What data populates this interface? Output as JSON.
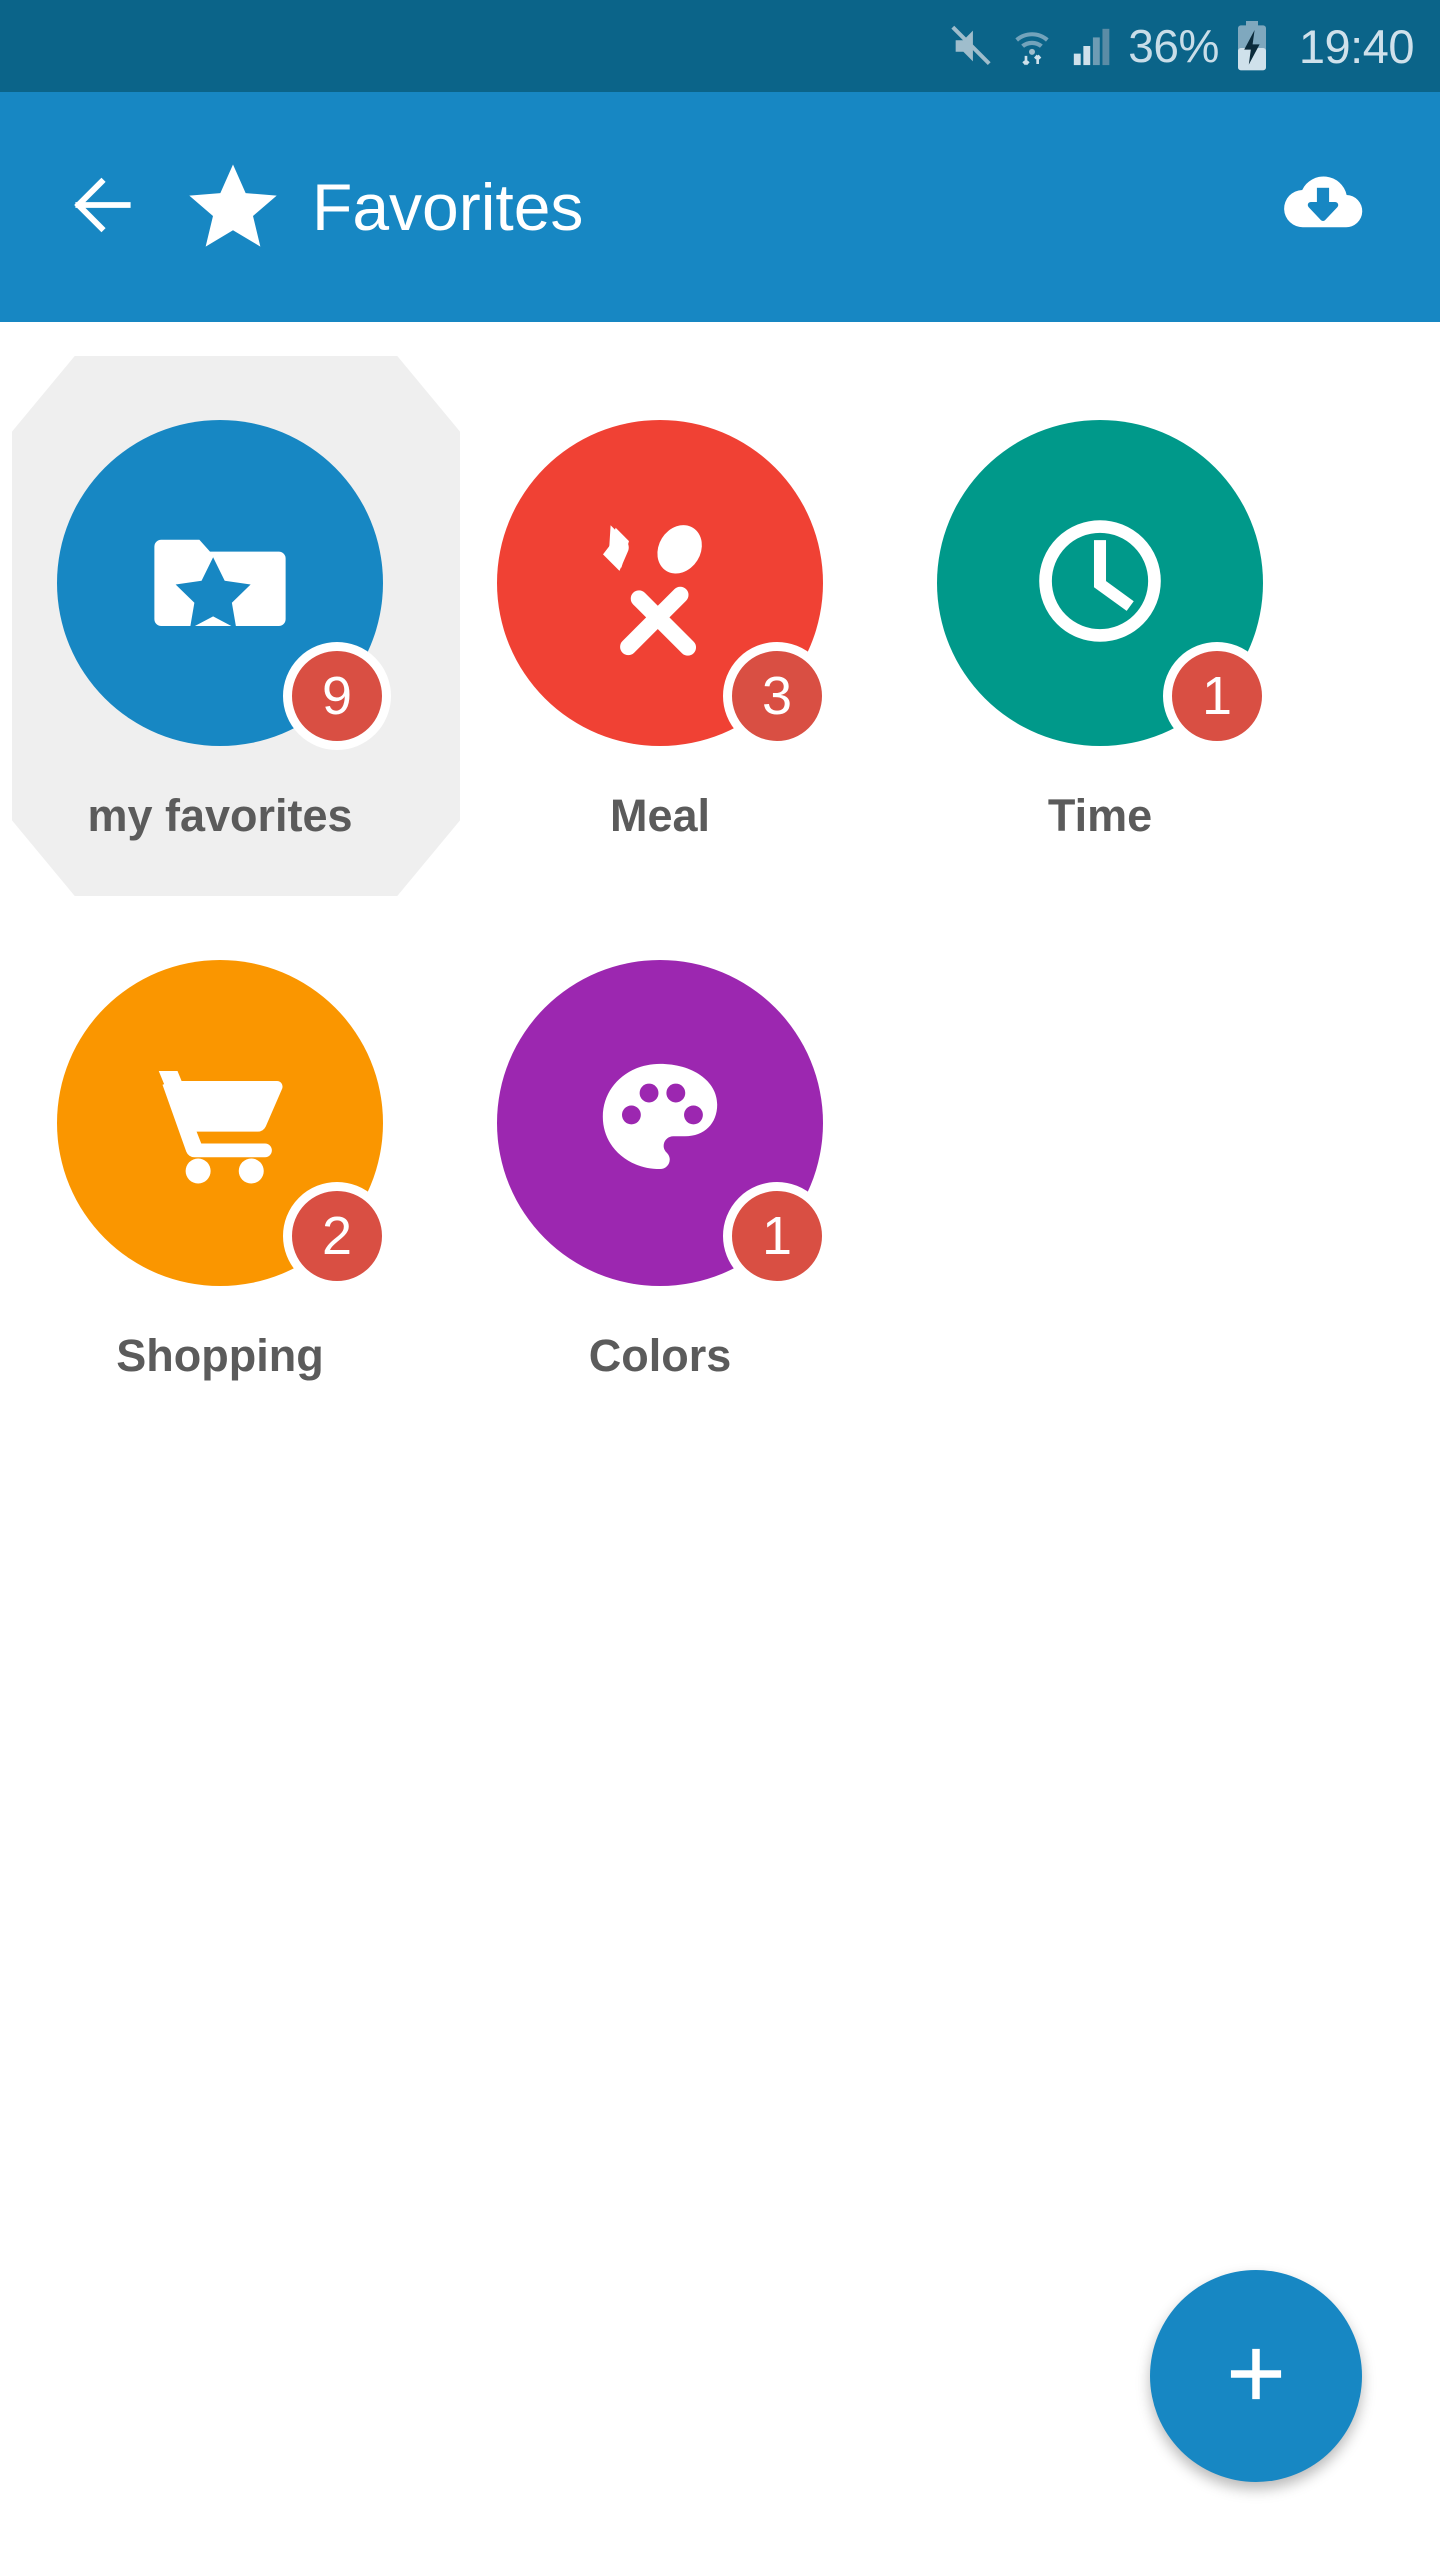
{
  "status_bar": {
    "battery_percent": "36%",
    "time": "19:40",
    "icons": [
      "mute-icon",
      "wifi-icon",
      "signal-icon",
      "battery-charging-icon"
    ],
    "background_color": "#0B6489",
    "text_color": "#C9DDE8"
  },
  "app_bar": {
    "title": "Favorites",
    "back_label": "back-arrow-icon",
    "star_label": "star-icon",
    "download_label": "cloud-download-icon",
    "background_color": "#1787C3"
  },
  "grid": {
    "tiles": [
      {
        "label": "my favorites",
        "badge": "9",
        "color": "#1787C3",
        "icon": "folder-star-icon",
        "selected": true
      },
      {
        "label": "Meal",
        "badge": "3",
        "color": "#F04134",
        "icon": "cutlery-icon",
        "selected": false
      },
      {
        "label": "Time",
        "badge": "1",
        "color": "#00998A",
        "icon": "clock-icon",
        "selected": false
      },
      {
        "label": "Shopping",
        "badge": "2",
        "color": "#FA9600",
        "icon": "shopping-cart-icon",
        "selected": false
      },
      {
        "label": "Colors",
        "badge": "1",
        "color": "#9C27B0",
        "icon": "palette-icon",
        "selected": false
      }
    ],
    "badge_color": "#D94F43",
    "label_color": "#5B5B5B",
    "selection_color": "#EFEFEF"
  },
  "fab": {
    "label": "add-button",
    "glyph": "+",
    "color": "#1787C3"
  }
}
